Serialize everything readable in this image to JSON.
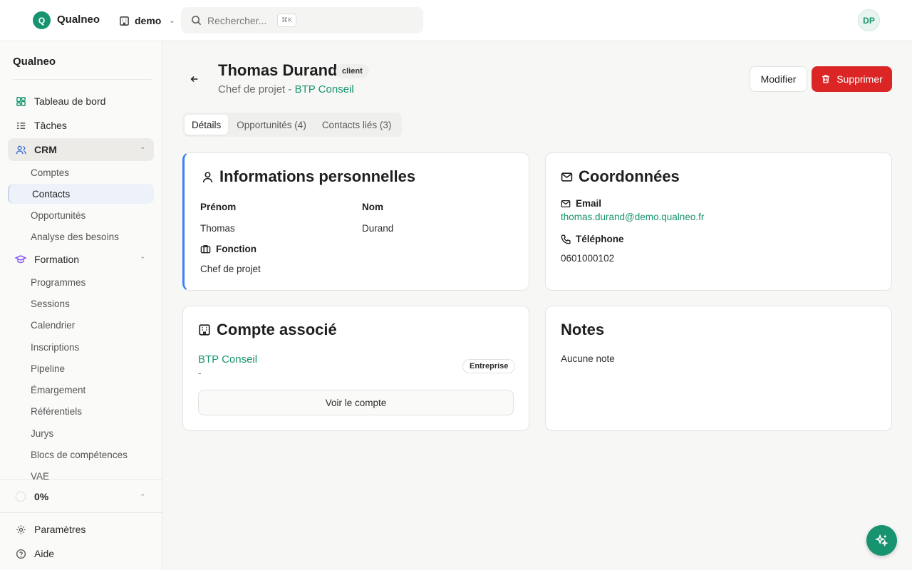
{
  "app": {
    "logo_letter": "Q",
    "brand": "Qualneo",
    "accent": "#17936f"
  },
  "workspace": {
    "name": "demo"
  },
  "search": {
    "placeholder": "Rechercher...",
    "shortcut": "⌘K"
  },
  "user": {
    "initials": "DP"
  },
  "sidebar": {
    "title": "Qualneo",
    "items": [
      {
        "label": "Tableau de bord",
        "icon": "dashboard-icon"
      },
      {
        "label": "Tâches",
        "icon": "tasks-icon"
      },
      {
        "label": "CRM",
        "icon": "users-icon"
      },
      {
        "label": "Formation",
        "icon": "graduation-cap-icon"
      }
    ],
    "crm_sub": [
      "Comptes",
      "Contacts",
      "Opportunités",
      "Analyse des besoins"
    ],
    "formation_sub": [
      "Programmes",
      "Sessions",
      "Calendrier",
      "Inscriptions",
      "Pipeline",
      "Émargement",
      "Référentiels",
      "Jurys",
      "Blocs de compétences",
      "VAE"
    ],
    "progress_label": "0%",
    "progress": 0,
    "settings": "Paramètres",
    "help": "Aide"
  },
  "contact": {
    "name": "Thomas Durand",
    "tag": "client",
    "role": "Chef de projet",
    "separator": " - ",
    "company": "BTP Conseil"
  },
  "actions": {
    "edit": "Modifier",
    "delete": "Supprimer",
    "delete_color": "#dc2626"
  },
  "tabs": [
    "Détails",
    "Opportunités (4)",
    "Contacts liés (3)"
  ],
  "personal": {
    "title": "Informations personnelles",
    "first_name_label": "Prénom",
    "first_name": "Thomas",
    "last_name_label": "Nom",
    "last_name": "Durand",
    "function_label": "Fonction",
    "function": "Chef de projet"
  },
  "coords": {
    "title": "Coordonnées",
    "email_label": "Email",
    "email": "thomas.durand@demo.qualneo.fr",
    "phone_label": "Téléphone",
    "phone": "0601000102"
  },
  "account": {
    "title": "Compte associé",
    "name": "BTP Conseil",
    "detail": "-",
    "type": "Entreprise",
    "view_button": "Voir le compte"
  },
  "notes": {
    "title": "Notes",
    "empty": "Aucune note"
  }
}
